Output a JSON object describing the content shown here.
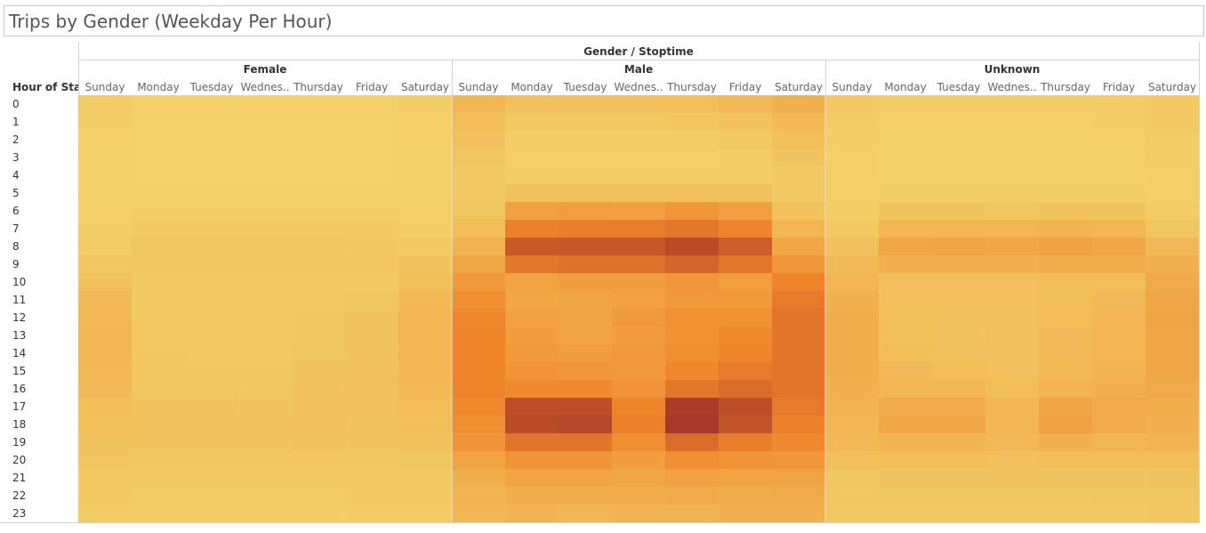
{
  "title": "Trips by Gender (Weekday Per Hour)",
  "row_header": "Hour of Sta..",
  "column_header": "Gender / Stoptime",
  "colors": {
    "low": "#f3d46a",
    "mid": "#f0842a",
    "high": "#a8392a"
  },
  "chart_data": {
    "type": "heatmap",
    "title": "Trips by Gender (Weekday Per Hour)",
    "column_header": "Gender / Stoptime",
    "row_header": "Hour of Sta..",
    "groups": [
      "Female",
      "Male",
      "Unknown"
    ],
    "day_labels": [
      "Sunday",
      "Monday",
      "Tuesday",
      "Wednes..",
      "Thursday",
      "Friday",
      "Saturday"
    ],
    "hours": [
      "0",
      "1",
      "2",
      "3",
      "4",
      "5",
      "6",
      "7",
      "8",
      "9",
      "10",
      "11",
      "12",
      "13",
      "14",
      "15",
      "16",
      "17",
      "18",
      "19",
      "20",
      "21",
      "22",
      "23"
    ],
    "intensity_scale": "relative 0-1",
    "values": {
      "Female": [
        [
          0.05,
          0.02,
          0.02,
          0.02,
          0.02,
          0.02,
          0.04
        ],
        [
          0.04,
          0.01,
          0.01,
          0.01,
          0.01,
          0.01,
          0.03
        ],
        [
          0.03,
          0.01,
          0.01,
          0.01,
          0.01,
          0.01,
          0.03
        ],
        [
          0.02,
          0.01,
          0.01,
          0.01,
          0.01,
          0.01,
          0.02
        ],
        [
          0.02,
          0.01,
          0.01,
          0.01,
          0.01,
          0.01,
          0.02
        ],
        [
          0.02,
          0.02,
          0.02,
          0.02,
          0.02,
          0.02,
          0.02
        ],
        [
          0.03,
          0.04,
          0.04,
          0.04,
          0.04,
          0.04,
          0.03
        ],
        [
          0.04,
          0.07,
          0.07,
          0.07,
          0.07,
          0.06,
          0.04
        ],
        [
          0.05,
          0.09,
          0.09,
          0.09,
          0.09,
          0.08,
          0.06
        ],
        [
          0.08,
          0.08,
          0.08,
          0.08,
          0.08,
          0.08,
          0.1
        ],
        [
          0.12,
          0.06,
          0.06,
          0.06,
          0.06,
          0.07,
          0.14
        ],
        [
          0.16,
          0.07,
          0.06,
          0.06,
          0.07,
          0.09,
          0.17
        ],
        [
          0.17,
          0.07,
          0.06,
          0.06,
          0.08,
          0.1,
          0.18
        ],
        [
          0.18,
          0.07,
          0.07,
          0.07,
          0.08,
          0.1,
          0.18
        ],
        [
          0.18,
          0.08,
          0.07,
          0.07,
          0.09,
          0.11,
          0.18
        ],
        [
          0.17,
          0.08,
          0.08,
          0.08,
          0.1,
          0.12,
          0.18
        ],
        [
          0.16,
          0.09,
          0.09,
          0.08,
          0.11,
          0.12,
          0.17
        ],
        [
          0.14,
          0.11,
          0.11,
          0.1,
          0.12,
          0.12,
          0.15
        ],
        [
          0.13,
          0.11,
          0.11,
          0.11,
          0.12,
          0.11,
          0.14
        ],
        [
          0.11,
          0.1,
          0.1,
          0.1,
          0.11,
          0.1,
          0.12
        ],
        [
          0.09,
          0.08,
          0.08,
          0.08,
          0.08,
          0.08,
          0.09
        ],
        [
          0.07,
          0.06,
          0.06,
          0.06,
          0.07,
          0.07,
          0.07
        ],
        [
          0.06,
          0.05,
          0.05,
          0.05,
          0.05,
          0.06,
          0.06
        ],
        [
          0.05,
          0.04,
          0.04,
          0.04,
          0.04,
          0.05,
          0.05
        ]
      ],
      "Male": [
        [
          0.18,
          0.12,
          0.12,
          0.12,
          0.13,
          0.16,
          0.22
        ],
        [
          0.15,
          0.07,
          0.07,
          0.07,
          0.08,
          0.1,
          0.17
        ],
        [
          0.12,
          0.04,
          0.04,
          0.04,
          0.04,
          0.06,
          0.13
        ],
        [
          0.09,
          0.03,
          0.03,
          0.03,
          0.03,
          0.04,
          0.1
        ],
        [
          0.07,
          0.04,
          0.04,
          0.04,
          0.04,
          0.04,
          0.07
        ],
        [
          0.06,
          0.12,
          0.12,
          0.12,
          0.12,
          0.12,
          0.06
        ],
        [
          0.09,
          0.32,
          0.34,
          0.33,
          0.38,
          0.33,
          0.11
        ],
        [
          0.14,
          0.52,
          0.55,
          0.55,
          0.58,
          0.5,
          0.18
        ],
        [
          0.21,
          0.78,
          0.8,
          0.8,
          0.88,
          0.76,
          0.28
        ],
        [
          0.28,
          0.58,
          0.62,
          0.62,
          0.7,
          0.58,
          0.38
        ],
        [
          0.36,
          0.3,
          0.34,
          0.34,
          0.38,
          0.34,
          0.5
        ],
        [
          0.44,
          0.28,
          0.3,
          0.32,
          0.36,
          0.36,
          0.56
        ],
        [
          0.48,
          0.32,
          0.3,
          0.36,
          0.42,
          0.42,
          0.6
        ],
        [
          0.5,
          0.34,
          0.3,
          0.34,
          0.42,
          0.46,
          0.6
        ],
        [
          0.5,
          0.36,
          0.34,
          0.36,
          0.44,
          0.5,
          0.6
        ],
        [
          0.5,
          0.4,
          0.38,
          0.36,
          0.48,
          0.56,
          0.6
        ],
        [
          0.5,
          0.46,
          0.46,
          0.4,
          0.58,
          0.66,
          0.6
        ],
        [
          0.46,
          0.86,
          0.86,
          0.5,
          0.98,
          0.86,
          0.56
        ],
        [
          0.44,
          0.88,
          0.9,
          0.52,
          1.0,
          0.82,
          0.52
        ],
        [
          0.4,
          0.6,
          0.6,
          0.44,
          0.66,
          0.54,
          0.46
        ],
        [
          0.3,
          0.4,
          0.4,
          0.34,
          0.44,
          0.4,
          0.38
        ],
        [
          0.24,
          0.3,
          0.3,
          0.28,
          0.32,
          0.3,
          0.3
        ],
        [
          0.2,
          0.24,
          0.24,
          0.24,
          0.26,
          0.25,
          0.26
        ],
        [
          0.18,
          0.2,
          0.19,
          0.2,
          0.2,
          0.22,
          0.22
        ]
      ],
      "Unknown": [
        [
          0.06,
          0.04,
          0.04,
          0.04,
          0.04,
          0.05,
          0.07
        ],
        [
          0.05,
          0.03,
          0.03,
          0.03,
          0.03,
          0.04,
          0.06
        ],
        [
          0.04,
          0.02,
          0.02,
          0.02,
          0.02,
          0.03,
          0.05
        ],
        [
          0.03,
          0.02,
          0.02,
          0.02,
          0.02,
          0.02,
          0.04
        ],
        [
          0.03,
          0.02,
          0.02,
          0.02,
          0.02,
          0.02,
          0.03
        ],
        [
          0.03,
          0.04,
          0.04,
          0.04,
          0.04,
          0.04,
          0.03
        ],
        [
          0.04,
          0.1,
          0.1,
          0.09,
          0.1,
          0.1,
          0.05
        ],
        [
          0.07,
          0.18,
          0.18,
          0.18,
          0.2,
          0.18,
          0.09
        ],
        [
          0.12,
          0.28,
          0.3,
          0.28,
          0.32,
          0.28,
          0.16
        ],
        [
          0.16,
          0.22,
          0.22,
          0.22,
          0.24,
          0.24,
          0.22
        ],
        [
          0.18,
          0.12,
          0.12,
          0.12,
          0.14,
          0.14,
          0.26
        ],
        [
          0.22,
          0.12,
          0.12,
          0.12,
          0.14,
          0.16,
          0.28
        ],
        [
          0.24,
          0.13,
          0.12,
          0.12,
          0.15,
          0.18,
          0.3
        ],
        [
          0.24,
          0.13,
          0.11,
          0.12,
          0.16,
          0.18,
          0.28
        ],
        [
          0.24,
          0.14,
          0.12,
          0.12,
          0.16,
          0.19,
          0.28
        ],
        [
          0.24,
          0.16,
          0.14,
          0.12,
          0.17,
          0.2,
          0.28
        ],
        [
          0.22,
          0.18,
          0.18,
          0.14,
          0.2,
          0.22,
          0.26
        ],
        [
          0.2,
          0.26,
          0.26,
          0.18,
          0.3,
          0.26,
          0.24
        ],
        [
          0.18,
          0.28,
          0.28,
          0.18,
          0.32,
          0.26,
          0.22
        ],
        [
          0.16,
          0.2,
          0.2,
          0.16,
          0.22,
          0.18,
          0.2
        ],
        [
          0.12,
          0.14,
          0.14,
          0.12,
          0.14,
          0.14,
          0.14
        ],
        [
          0.09,
          0.1,
          0.1,
          0.1,
          0.1,
          0.1,
          0.11
        ],
        [
          0.08,
          0.08,
          0.08,
          0.08,
          0.08,
          0.09,
          0.09
        ],
        [
          0.07,
          0.06,
          0.06,
          0.06,
          0.06,
          0.07,
          0.08
        ]
      ]
    }
  }
}
